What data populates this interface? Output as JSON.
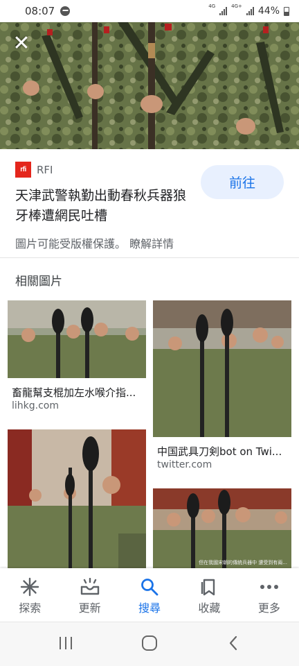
{
  "status_bar": {
    "time": "08:07",
    "network_1": "4G",
    "network_2": "4G+",
    "battery": "44%"
  },
  "hero": {
    "close_icon": "close-icon"
  },
  "source": {
    "logo_text": "rfi",
    "name": "RFI",
    "visit_label": "前往",
    "title": "天津武警執勤出動春秋兵器狼牙棒遭網民吐槽",
    "copyright_notice": "圖片可能受版權保護。",
    "learn_more": "瞭解詳情"
  },
  "related": {
    "heading": "相關圖片",
    "items": [
      {
        "caption": "畜龍幫支棍加左水喉介指...",
        "domain": "lihkg.com"
      },
      {
        "caption": "中国武具刀剣bot on Twi...",
        "domain": "twitter.com"
      },
      {
        "caption": "",
        "domain": ""
      },
      {
        "caption": "",
        "domain": "",
        "watermark": "但在我國宋朝的傳統兵器中 遭受到有兩..."
      }
    ]
  },
  "bottom_nav": {
    "items": [
      {
        "label": "探索",
        "icon": "asterisk-icon",
        "active": false
      },
      {
        "label": "更新",
        "icon": "inbox-tray-icon",
        "active": false
      },
      {
        "label": "搜尋",
        "icon": "search-icon",
        "active": true
      },
      {
        "label": "收藏",
        "icon": "bookmark-icon",
        "active": false
      },
      {
        "label": "更多",
        "icon": "more-dots-icon",
        "active": false
      }
    ]
  },
  "system_nav": {
    "buttons": [
      "recent-apps-icon",
      "home-icon",
      "back-icon"
    ]
  },
  "colors": {
    "accent": "#1a73e8",
    "visit_button_bg": "#e8f0fe",
    "rfi_red": "#e4261c"
  }
}
